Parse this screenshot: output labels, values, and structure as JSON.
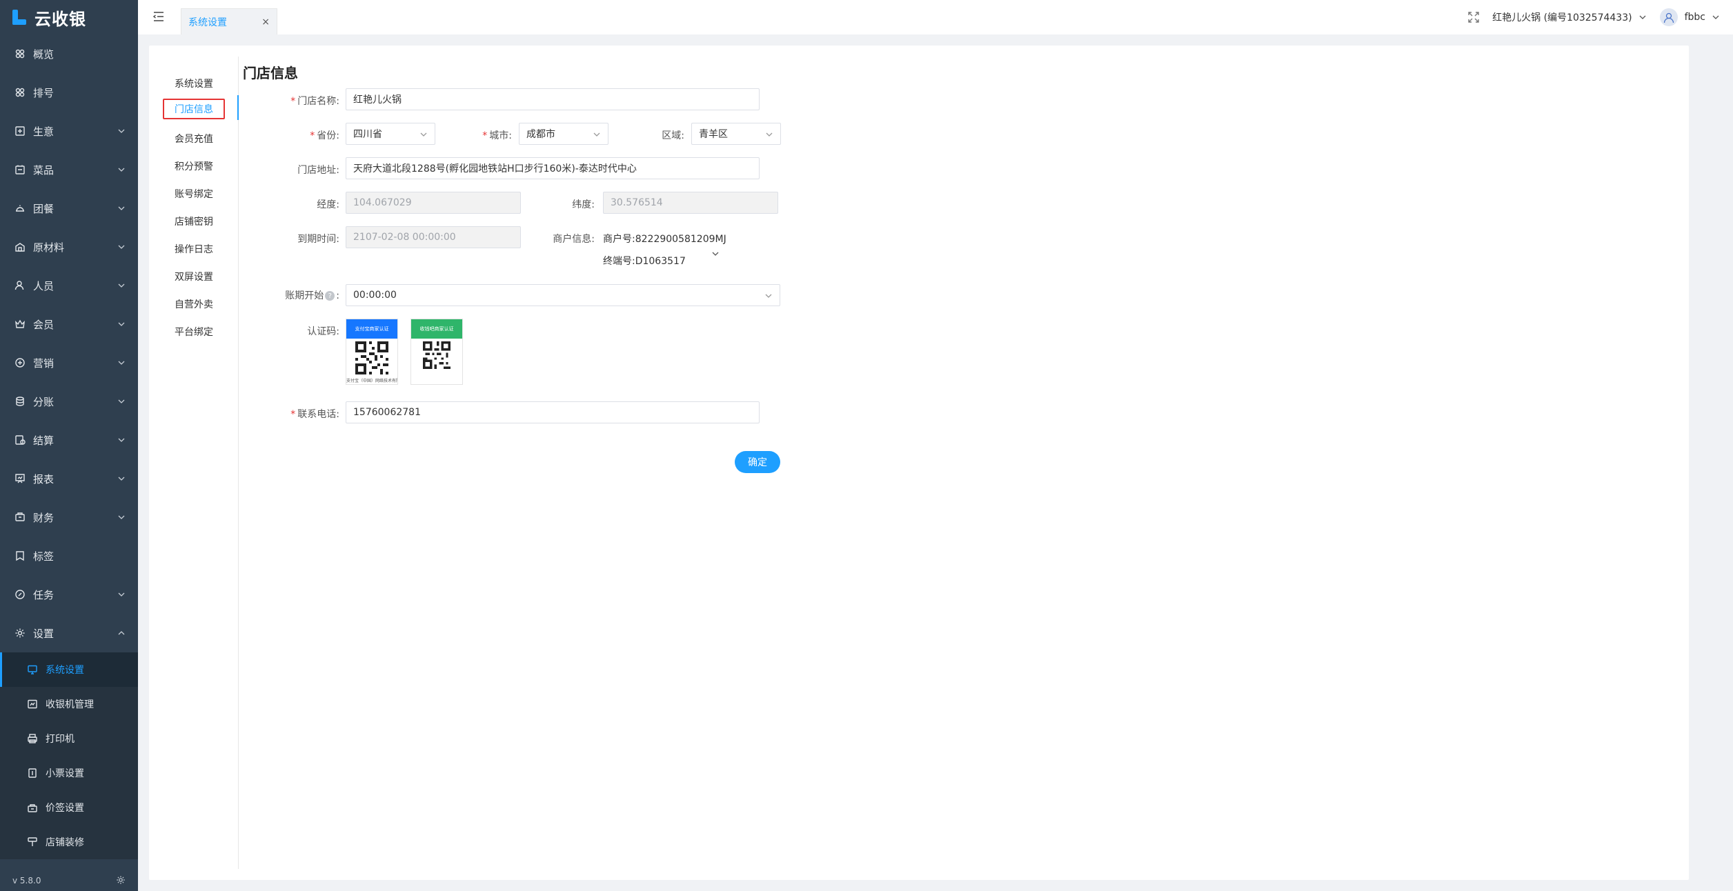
{
  "app": {
    "logo_text": "云收银",
    "version": "v 5.8.0"
  },
  "sidebar": {
    "items": [
      {
        "label": "概览",
        "icon": "overview-icon",
        "has_arrow": false
      },
      {
        "label": "排号",
        "icon": "queue-icon",
        "has_arrow": false
      },
      {
        "label": "生意",
        "icon": "business-icon",
        "has_arrow": true
      },
      {
        "label": "菜品",
        "icon": "dish-icon",
        "has_arrow": true
      },
      {
        "label": "团餐",
        "icon": "group-meal-icon",
        "has_arrow": true
      },
      {
        "label": "原材料",
        "icon": "materials-icon",
        "has_arrow": true
      },
      {
        "label": "人员",
        "icon": "staff-icon",
        "has_arrow": true
      },
      {
        "label": "会员",
        "icon": "member-icon",
        "has_arrow": true
      },
      {
        "label": "营销",
        "icon": "marketing-icon",
        "has_arrow": true
      },
      {
        "label": "分账",
        "icon": "split-account-icon",
        "has_arrow": true
      },
      {
        "label": "结算",
        "icon": "settlement-icon",
        "has_arrow": true
      },
      {
        "label": "报表",
        "icon": "report-icon",
        "has_arrow": true
      },
      {
        "label": "财务",
        "icon": "finance-icon",
        "has_arrow": true
      },
      {
        "label": "标签",
        "icon": "tag-icon",
        "has_arrow": false
      },
      {
        "label": "任务",
        "icon": "task-icon",
        "has_arrow": true
      },
      {
        "label": "设置",
        "icon": "settings-icon",
        "has_arrow": true,
        "expanded": true
      }
    ],
    "sub_items": [
      {
        "label": "系统设置",
        "icon": "monitor-icon",
        "active": true
      },
      {
        "label": "收银机管理",
        "icon": "cash-register-icon",
        "active": false
      },
      {
        "label": "打印机",
        "icon": "printer-icon",
        "active": false
      },
      {
        "label": "小票设置",
        "icon": "receipt-icon",
        "active": false
      },
      {
        "label": "价签设置",
        "icon": "price-tag-icon",
        "active": false
      },
      {
        "label": "店铺装修",
        "icon": "decoration-icon",
        "active": false
      }
    ]
  },
  "topbar": {
    "tab_label": "系统设置",
    "tab_close": "×",
    "store_name": "红艳儿火锅 (编号1032574433)",
    "user_name": "fbbc"
  },
  "subnav": {
    "items": [
      "系统设置",
      "门店信息",
      "会员充值",
      "积分预警",
      "账号绑定",
      "店铺密钥",
      "操作日志",
      "双屏设置",
      "自营外卖",
      "平台绑定"
    ],
    "active_index": 1
  },
  "form": {
    "title": "门店信息",
    "store_name_label": "门店名称:",
    "store_name_value": "红艳儿火锅",
    "province_label": "省份:",
    "province_value": "四川省",
    "city_label": "城市:",
    "city_value": "成都市",
    "district_label": "区域:",
    "district_value": "青羊区",
    "address_label": "门店地址:",
    "address_value": "天府大道北段1288号(孵化园地铁站H口步行160米)-泰达时代中心",
    "longitude_label": "经度:",
    "longitude_value": "104.067029",
    "latitude_label": "纬度:",
    "latitude_value": "30.576514",
    "expiry_label": "到期时间:",
    "expiry_value": "2107-02-08 00:00:00",
    "merchant_label": "商户信息:",
    "merchant_no": "商户号:8222900581209MJ",
    "terminal_no": "终端号:D1063517",
    "billing_label": "账期开始",
    "billing_help": "?",
    "billing_colon": ":",
    "billing_value": "00:00:00",
    "cert_label": "认证码:",
    "qr1_title": "支付宝商家认证",
    "qr1_foot": "支付宝（中国）网络技术有限公司",
    "qr2_title": "收钱吧商家认证",
    "phone_label": "联系电话:",
    "phone_value": "15760062781",
    "confirm_label": "确定"
  },
  "colors": {
    "accent": "#1e9fff",
    "sidebar_bg": "#2f3f4f",
    "required": "#e53333",
    "active_outline": "#e53333"
  }
}
